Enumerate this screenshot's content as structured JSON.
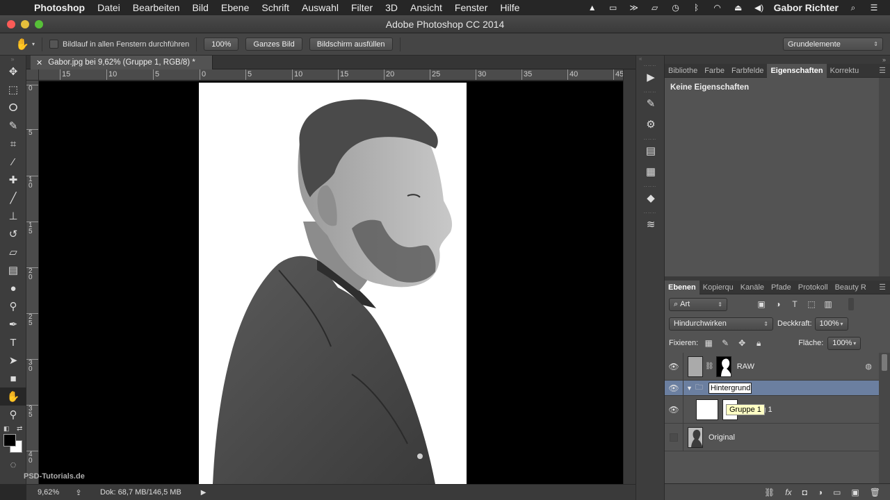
{
  "menubar": {
    "apple": "",
    "items": [
      "Photoshop",
      "Datei",
      "Bearbeiten",
      "Bild",
      "Ebene",
      "Schrift",
      "Auswahl",
      "Filter",
      "3D",
      "Ansicht",
      "Fenster",
      "Hilfe"
    ],
    "user": "Gabor Richter"
  },
  "window": {
    "title": "Adobe Photoshop CC 2014"
  },
  "options": {
    "scroll_all_label": "Bildlauf in allen Fenstern durchführen",
    "zoom_100_label": "100%",
    "fit_screen_label": "Ganzes Bild",
    "fill_screen_label": "Bildschirm ausfüllen",
    "workspace_label": "Grundelemente"
  },
  "document": {
    "tab_title": "Gabor.jpg bei 9,62% (Gruppe 1, RGB/8) *",
    "ruler_h": [
      "15",
      "10",
      "5",
      "0",
      "5",
      "10",
      "15",
      "20",
      "25",
      "30",
      "35",
      "40",
      "45"
    ],
    "ruler_v": [
      "0",
      "5",
      "1\n0",
      "1\n5",
      "2\n0",
      "2\n5",
      "3\n0",
      "3\n5",
      "4\n0"
    ]
  },
  "status": {
    "zoom": "9,62%",
    "doc_size": "Dok: 68,7 MB/146,5 MB",
    "watermark": "PSD-Tutorials.de"
  },
  "properties_panel": {
    "tabs": [
      "Bibliothe",
      "Farbe",
      "Farbfelde",
      "Eigenschaften",
      "Korrektu"
    ],
    "active_tab": "Eigenschaften",
    "title": "Keine Eigenschaften"
  },
  "layers_panel": {
    "tabs": [
      "Ebenen",
      "Kopierqu",
      "Kanäle",
      "Pfade",
      "Protokoll",
      "Beauty R"
    ],
    "active_tab": "Ebenen",
    "filter_label": "Art",
    "blend_mode": "Hindurchwirken",
    "opacity_label": "Deckkraft:",
    "opacity_value": "100%",
    "lock_label": "Fixieren:",
    "fill_label": "Fläche:",
    "fill_value": "100%",
    "layers": [
      {
        "name": "RAW",
        "visible": true
      },
      {
        "name": "Hintergrund",
        "visible": true,
        "editing": true
      },
      {
        "name": "füllung 1",
        "visible": true
      },
      {
        "name": "Original",
        "visible": false
      }
    ],
    "tooltip": "Gruppe 1"
  }
}
